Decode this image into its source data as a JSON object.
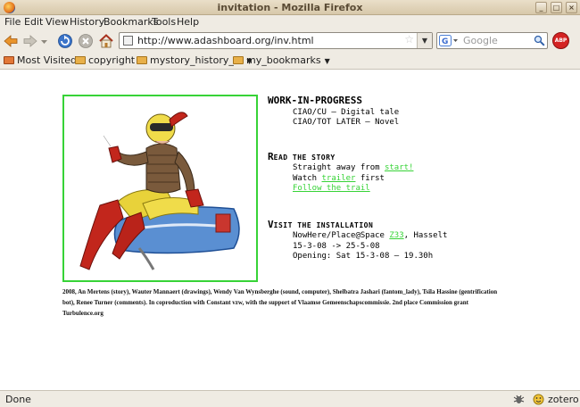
{
  "window": {
    "title": "invitation - Mozilla Firefox",
    "controls": [
      "_",
      "□",
      "×"
    ]
  },
  "menu": [
    "File",
    "Edit",
    "View",
    "History",
    "Bookmarks",
    "Tools",
    "Help"
  ],
  "navbar": {
    "url": "http://www.adashboard.org/inv.html",
    "search_placeholder": "Google",
    "adblock_label": "ABP"
  },
  "bookmarks": [
    "Most Visited",
    "copyright",
    "mystory_history_...",
    "my_bookmarks"
  ],
  "page": {
    "sections": {
      "wip": {
        "heading": "WORK-IN-PROGRESS",
        "lines": [
          "CIAO/CU – Digital tale",
          "CIAO/TOT LATER – Novel"
        ]
      },
      "read": {
        "heading_initial": "R",
        "heading_rest": "EAD THE STORY",
        "line1_prefix": "Straight away from ",
        "line1_link": "start!",
        "line2_prefix": "Watch ",
        "line2_link": "trailer",
        "line2_suffix": " first",
        "line3_link": "Follow the trail"
      },
      "visit": {
        "heading_initial": "V",
        "heading_rest": "ISIT THE INSTALLATION",
        "line1_prefix": "NowHere/Place@Space ",
        "line1_link": "Z33",
        "line1_suffix": ", Hasselt",
        "line2": "15-3-08 -> 25-5-08",
        "line3": "Opening: Sat 15-3-08 – 19.30h"
      }
    },
    "credits": "2008, An Mertens (story), Wauter Mannaert (drawings), Wendy Van Wynsberghe (sound, computer), Shelbatra Jashari (fantom_lady), Tsila Hassine (gentrification bot), Renee Turner (comments). In coproduction with Constant vzw, with the support of Vlaamse Gemeenschapscommissie. 2nd place Commission grant Turbulence.org"
  },
  "status": {
    "text": "Done",
    "zotero": "zotero"
  },
  "colors": {
    "link_green": "#37d337",
    "chrome_bg": "#efebe3"
  }
}
